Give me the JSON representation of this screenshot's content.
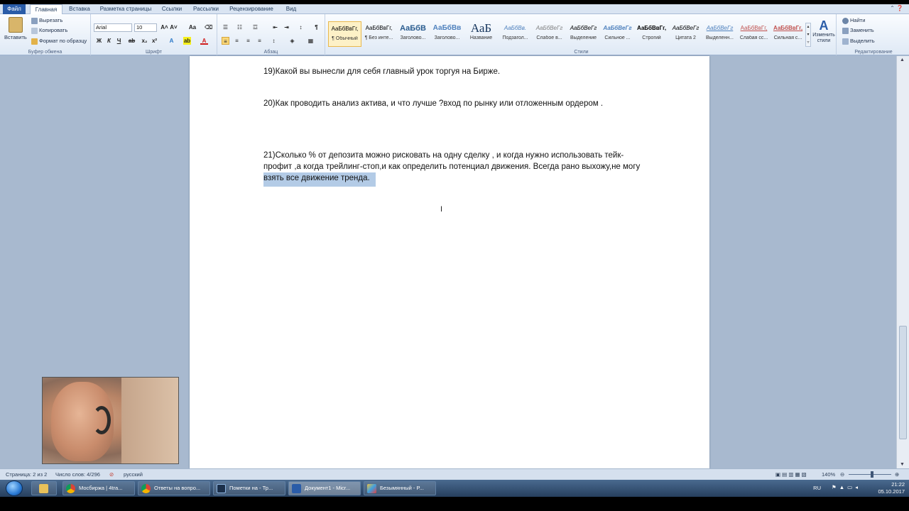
{
  "ribbon_tabs": [
    "Файл",
    "Главная",
    "Вставка",
    "Разметка страницы",
    "Ссылки",
    "Рассылки",
    "Рецензирование",
    "Вид"
  ],
  "clipboard": {
    "paste": "Вставить",
    "cut": "Вырезать",
    "copy": "Копировать",
    "format_painter": "Формат по образцу",
    "label": "Буфер обмена"
  },
  "font": {
    "name": "Arial",
    "size": "10",
    "label": "Шрифт",
    "bold": "Ж",
    "italic": "К",
    "underline": "Ч",
    "grow": "A˄",
    "shrink": "A˅",
    "change_case": "Aa"
  },
  "paragraph": {
    "label": "Абзац",
    "pilcrow": "¶"
  },
  "styles": {
    "label": "Стили",
    "items": [
      {
        "sample": "АаБбВвГг,",
        "name": "¶ Обычный"
      },
      {
        "sample": "АаБбВвГг,",
        "name": "¶ Без инте..."
      },
      {
        "sample": "АаБбВ",
        "name": "Заголово..."
      },
      {
        "sample": "АаБбВв",
        "name": "Заголово..."
      },
      {
        "sample": "АаБ",
        "name": "Название"
      },
      {
        "sample": "АаБбВв.",
        "name": "Подзагол..."
      },
      {
        "sample": "АаБбВеГг",
        "name": "Слабое в..."
      },
      {
        "sample": "АаБбВеГг",
        "name": "Выделение"
      },
      {
        "sample": "АаБбВеГг",
        "name": "Сильное ..."
      },
      {
        "sample": "АаБбВвГг,",
        "name": "Строгий"
      },
      {
        "sample": "АаБбВеГг",
        "name": "Цитата 2"
      },
      {
        "sample": "АаБбВеГг",
        "name": "Выделенн..."
      },
      {
        "sample": "АаБбВвГг,",
        "name": "Слабая сс..."
      },
      {
        "sample": "АаБбВвГг,",
        "name": "Сильная с..."
      }
    ],
    "change_styles": "Изменить стили"
  },
  "editing": {
    "label": "Редактирование",
    "find": "Найти",
    "replace": "Заменить",
    "select": "Выделить"
  },
  "document": {
    "p19": "19)Какой вы вынесли для себя главный урок торгуя на Бирже.",
    "p20": "20)Как проводить анализ актива, и что лучше ?вход по рынку или отложенным ордером .",
    "p21_line1": "21)Сколько % от депозита можно рисковать на одну сделку , и когда нужно использовать тейк-",
    "p21_line2": "профит ,а когда трейлинг-стоп,и как определить потенциал движения. Всегда рано выхожу,не могу",
    "p21_line3": "взять все движение тренда."
  },
  "status": {
    "page": "Страница: 2 из 2",
    "words": "Число слов: 4/296",
    "language": "русский",
    "zoom": "140%"
  },
  "taskbar": {
    "tasks": [
      {
        "label": "Мосбиржа | 4tra..."
      },
      {
        "label": "Ответы на вопро..."
      },
      {
        "label": "Пометки на - Тр..."
      },
      {
        "label": "Документ1 - Micr..."
      },
      {
        "label": "Безымянный - P..."
      }
    ],
    "lang": "RU",
    "time": "21:22",
    "date": "05.10.2017"
  },
  "colors": {
    "file_tab": "#2a5ca8",
    "selection": "#b3cbe6",
    "ribbon_bg": "#dfe9f5",
    "workspace": "#a8b9cf"
  }
}
